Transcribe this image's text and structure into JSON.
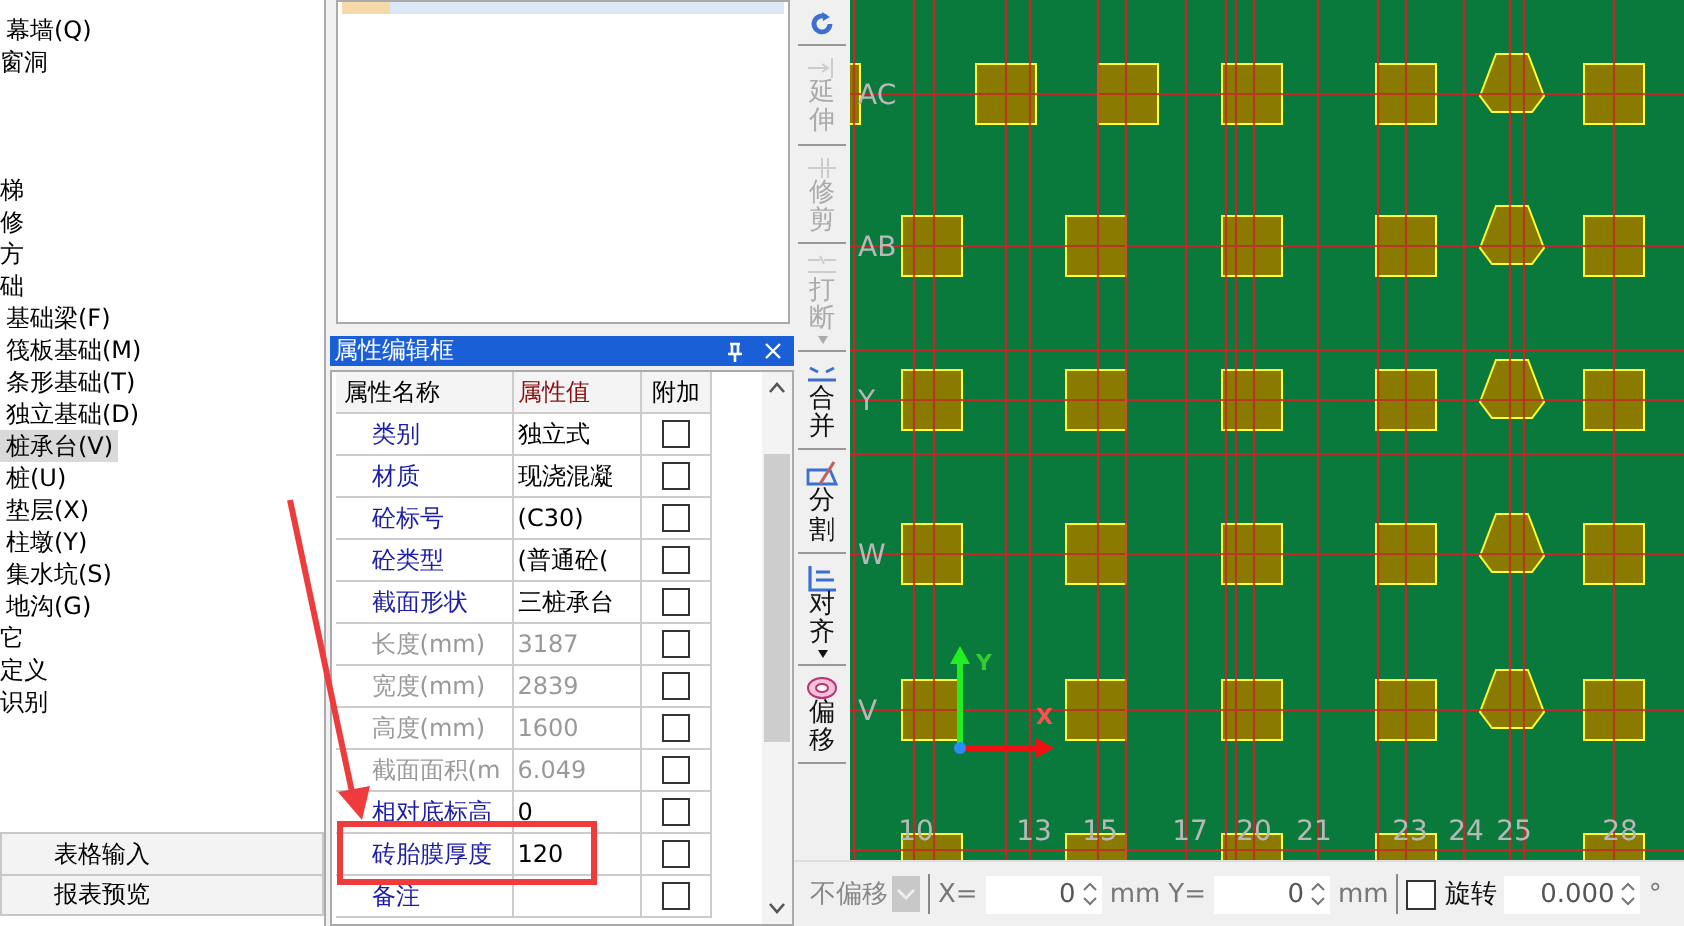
{
  "tree": {
    "partial_children": [
      {
        "label": "幕墙(Q)",
        "selected": false
      }
    ],
    "groups": [
      [
        {
          "label": "窗洞",
          "selected": false
        }
      ],
      [
        {
          "label": "梯",
          "selected": false
        },
        {
          "label": "修",
          "selected": false
        },
        {
          "label": "方",
          "selected": false
        },
        {
          "label": "础",
          "selected": false,
          "children": [
            {
              "label": "基础梁(F)",
              "selected": false
            },
            {
              "label": "筏板基础(M)",
              "selected": false
            },
            {
              "label": "条形基础(T)",
              "selected": false
            },
            {
              "label": "独立基础(D)",
              "selected": false
            },
            {
              "label": "桩承台(V)",
              "selected": true
            },
            {
              "label": "桩(U)",
              "selected": false
            },
            {
              "label": "垫层(X)",
              "selected": false
            },
            {
              "label": "柱墩(Y)",
              "selected": false
            },
            {
              "label": "集水坑(S)",
              "selected": false
            },
            {
              "label": "地沟(G)",
              "selected": false
            }
          ]
        },
        {
          "label": "它",
          "selected": false
        },
        {
          "label": "定义",
          "selected": false
        },
        {
          "label": "识别",
          "selected": false
        }
      ]
    ]
  },
  "left_buttons": [
    "表格输入",
    "报表预览"
  ],
  "property_panel": {
    "title": "属性编辑框",
    "columns": [
      "属性名称",
      "属性值",
      "附加"
    ],
    "rows": [
      {
        "name": "类别",
        "value": "独立式",
        "disabled": false,
        "checked": false
      },
      {
        "name": "材质",
        "value": "现浇混凝",
        "disabled": false,
        "checked": false
      },
      {
        "name": "砼标号",
        "value": "(C30)",
        "disabled": false,
        "checked": false
      },
      {
        "name": "砼类型",
        "value": "(普通砼(",
        "disabled": false,
        "checked": false
      },
      {
        "name": "截面形状",
        "value": "三桩承台",
        "disabled": false,
        "checked": false
      },
      {
        "name": "长度(mm)",
        "value": "3187",
        "disabled": true,
        "checked": false
      },
      {
        "name": "宽度(mm)",
        "value": "2839",
        "disabled": true,
        "checked": false
      },
      {
        "name": "高度(mm)",
        "value": "1600",
        "disabled": true,
        "checked": false
      },
      {
        "name": "截面面积(m",
        "value": "6.049",
        "disabled": true,
        "checked": false
      },
      {
        "name": "相对底标高",
        "value": "0",
        "disabled": false,
        "checked": false
      },
      {
        "name": "砖胎膜厚度",
        "value": "120",
        "disabled": false,
        "checked": false
      },
      {
        "name": "备注",
        "value": "",
        "disabled": false,
        "checked": false
      }
    ]
  },
  "toolbar": [
    {
      "kind": "refresh",
      "disabled": false,
      "has_menu": false
    },
    {
      "kind": "extend",
      "label": "延伸",
      "disabled": true,
      "has_menu": false
    },
    {
      "kind": "trim",
      "label": "修剪",
      "disabled": true,
      "has_menu": false
    },
    {
      "kind": "break",
      "label": "打断",
      "disabled": true,
      "has_menu": true
    },
    {
      "kind": "merge",
      "label": "合并",
      "disabled": false,
      "has_menu": false
    },
    {
      "kind": "split",
      "label": "分割",
      "disabled": false,
      "has_menu": false
    },
    {
      "kind": "align",
      "label": "对齐",
      "disabled": false,
      "has_menu": true
    },
    {
      "kind": "offset",
      "label": "偏移",
      "disabled": false,
      "has_menu": false
    }
  ],
  "canvas": {
    "row_labels": [
      "AC",
      "AB",
      "Y",
      "W",
      "V"
    ],
    "column_labels": [
      "10",
      "13",
      "15",
      "17",
      "20",
      "21",
      "23",
      "24",
      "25",
      "28"
    ],
    "ucs": {
      "x": "X",
      "y": "Y"
    }
  },
  "offset_bar": {
    "mode": "不偏移",
    "x_label": "X=",
    "x_value": "0",
    "x_unit": "mm",
    "y_label": "Y=",
    "y_value": "0",
    "y_unit": "mm",
    "rotate_checked": false,
    "rotate_label": "旋转",
    "angle": "0.000",
    "angle_unit": "°"
  }
}
